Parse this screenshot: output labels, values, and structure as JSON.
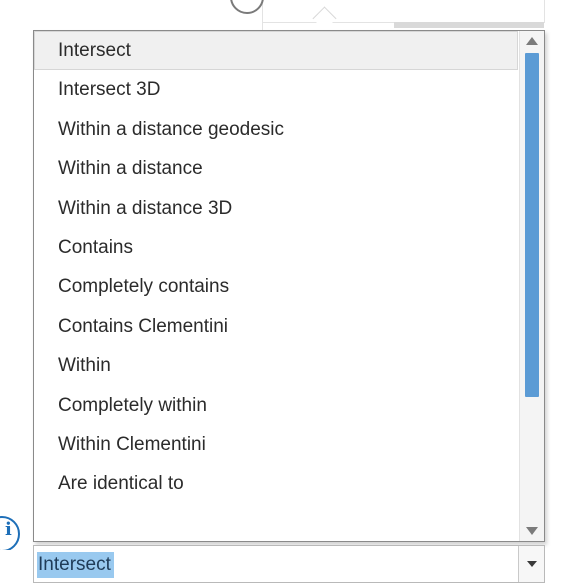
{
  "dropdown": {
    "items": [
      {
        "label": "Intersect",
        "selected": true
      },
      {
        "label": "Intersect 3D",
        "selected": false
      },
      {
        "label": "Within a distance geodesic",
        "selected": false
      },
      {
        "label": "Within a distance",
        "selected": false
      },
      {
        "label": "Within a distance 3D",
        "selected": false
      },
      {
        "label": "Contains",
        "selected": false
      },
      {
        "label": "Completely contains",
        "selected": false
      },
      {
        "label": "Contains Clementini",
        "selected": false
      },
      {
        "label": "Within",
        "selected": false
      },
      {
        "label": "Completely within",
        "selected": false
      },
      {
        "label": "Within Clementini",
        "selected": false
      },
      {
        "label": "Are identical to",
        "selected": false
      }
    ]
  },
  "combobox": {
    "value": "Intersect"
  },
  "icons": {
    "info": "info-icon",
    "scroll_up": "scroll-up-arrow-icon",
    "scroll_down": "scroll-down-arrow-icon",
    "dropdown_arrow": "chevron-down-icon"
  },
  "colors": {
    "selection_highlight": "#99c9ef",
    "scroll_thumb": "#5b9bd5",
    "info_icon": "#1e6fb8",
    "selected_item_bg": "#f0f0f0"
  }
}
